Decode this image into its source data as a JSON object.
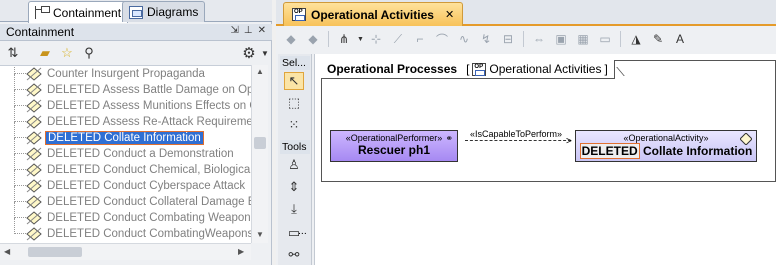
{
  "left": {
    "tabs": [
      {
        "label": "Containment",
        "icon": "containment-tree-icon"
      },
      {
        "label": "Diagrams",
        "icon": "diagrams-icon"
      }
    ],
    "header": {
      "title": "Containment",
      "controls": [
        "pin-icon",
        "minimize-icon",
        "close-icon"
      ]
    },
    "toolbar_icons": [
      "collapse-all-icon",
      "open-folder-icon",
      "favorite-star-icon",
      "search-icon",
      "gear-icon"
    ],
    "tree": [
      {
        "label": "Counter Insurgent Propaganda",
        "selected": false
      },
      {
        "label": "DELETED Assess Battle Damage on Operat",
        "selected": false
      },
      {
        "label": "DELETED Assess Munitions Effects on Oper",
        "selected": false
      },
      {
        "label": "DELETED Assess Re-Attack Requirement",
        "selected": false
      },
      {
        "label": "DELETED Collate Information",
        "selected": true
      },
      {
        "label": "DELETED Conduct a Demonstration",
        "selected": false
      },
      {
        "label": "DELETED Conduct Chemical, Biological, Rad",
        "selected": false
      },
      {
        "label": "DELETED Conduct Cyberspace Attack",
        "selected": false
      },
      {
        "label": "DELETED Conduct Collateral Damage Estim",
        "selected": false
      },
      {
        "label": "DELETED Conduct Combating Weapons of",
        "selected": false
      },
      {
        "label": "DELETED Conduct CombatingWeapons of M",
        "selected": false
      }
    ]
  },
  "right": {
    "tab": {
      "label": "Operational Activities",
      "close": "✕"
    },
    "palette": {
      "selection_label": "Sel...",
      "tools_label": "Tools",
      "more_label": "..."
    },
    "frame": {
      "title": "Operational Processes",
      "diagram_ref": "Operational Activities",
      "open_bracket": "[",
      "close_bracket": "]"
    },
    "performer": {
      "stereotype": "«OperationalPerformer»",
      "name": "Rescuer ph1"
    },
    "relation": {
      "label": "«IsCapableToPerform»"
    },
    "activity": {
      "stereotype": "«OperationalActivity»",
      "deleted_tag": "DELETED",
      "name": "Collate Information"
    }
  },
  "colors": {
    "selection": "#2f6fd3",
    "highlight_border": "#e07030",
    "tab_accent": "#e59b2a",
    "performer_fill": "#a689f2",
    "activity_fill": "#c9c5f5"
  }
}
